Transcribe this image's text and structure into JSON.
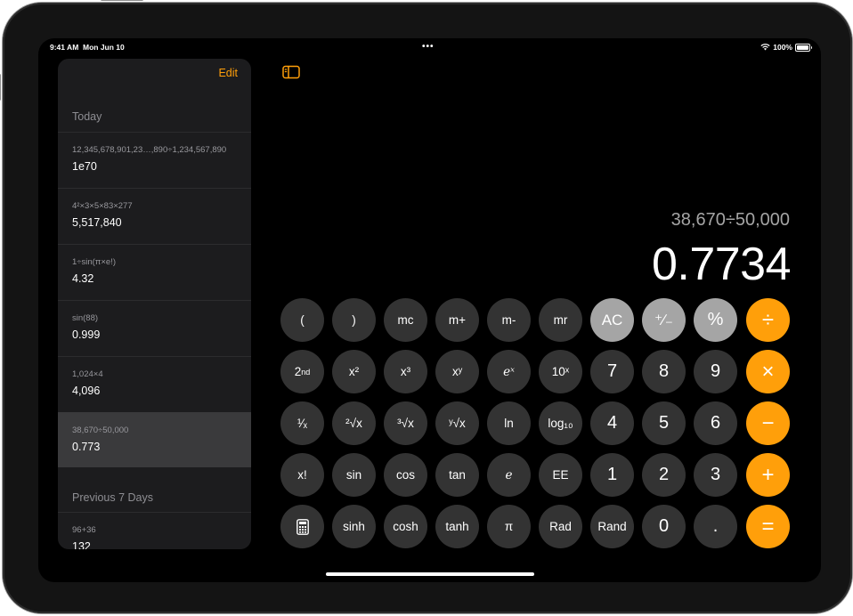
{
  "status_bar": {
    "time": "9:41 AM  Mon Jun 10",
    "dots": "•••",
    "battery": "100%"
  },
  "sidebar": {
    "edit_label": "Edit",
    "today_label": "Today",
    "previous_label": "Previous 7 Days",
    "history": [
      {
        "expr": "12,345,678,901,23…,890÷1,234,567,890",
        "result": "1e70"
      },
      {
        "expr": "4²×3×5×83×277",
        "result": "5,517,840"
      },
      {
        "expr": "1÷sin(π×e!)",
        "result": "4.32"
      },
      {
        "expr": "sin(88)",
        "result": "0.999"
      },
      {
        "expr": "1,024×4",
        "result": "4,096"
      },
      {
        "expr": "38,670÷50,000",
        "result": "0.773"
      }
    ],
    "previous_history": [
      {
        "expr": "96+36",
        "result": "132"
      }
    ]
  },
  "display": {
    "expression": "38,670÷50,000",
    "result": "0.7734"
  },
  "keys": {
    "open_paren": "(",
    "close_paren": ")",
    "mc": "mc",
    "m_plus": "m+",
    "m_minus": "m-",
    "mr": "mr",
    "ac": "AC",
    "plus_minus": "⁺∕₋",
    "percent": "%",
    "divide": "÷",
    "second": "2nd",
    "x_squared": "x²",
    "x_cubed": "x³",
    "x_pow_y": "xʸ",
    "e_pow_x": "eˣ",
    "ten_pow_x": "10ˣ",
    "seven": "7",
    "eight": "8",
    "nine": "9",
    "multiply": "×",
    "reciprocal": "¹⁄ₓ",
    "sqrt": "²√x",
    "cbrt": "³√x",
    "yroot": "ʸ√x",
    "ln": "ln",
    "log10": "log₁₀",
    "four": "4",
    "five": "5",
    "six": "6",
    "minus": "−",
    "factorial": "x!",
    "sin": "sin",
    "cos": "cos",
    "tan": "tan",
    "e": "e",
    "ee": "EE",
    "one": "1",
    "two": "2",
    "three": "3",
    "plus": "+",
    "sinh": "sinh",
    "cosh": "cosh",
    "tanh": "tanh",
    "pi": "π",
    "rad": "Rad",
    "rand": "Rand",
    "zero": "0",
    "decimal": ".",
    "equals": "="
  },
  "colors": {
    "accent": "#ff9f0a",
    "key_dark": "#333333",
    "key_light": "#a5a5a5",
    "background": "#000000",
    "sidebar": "#1c1c1e",
    "selected_row": "#3a3a3c"
  }
}
